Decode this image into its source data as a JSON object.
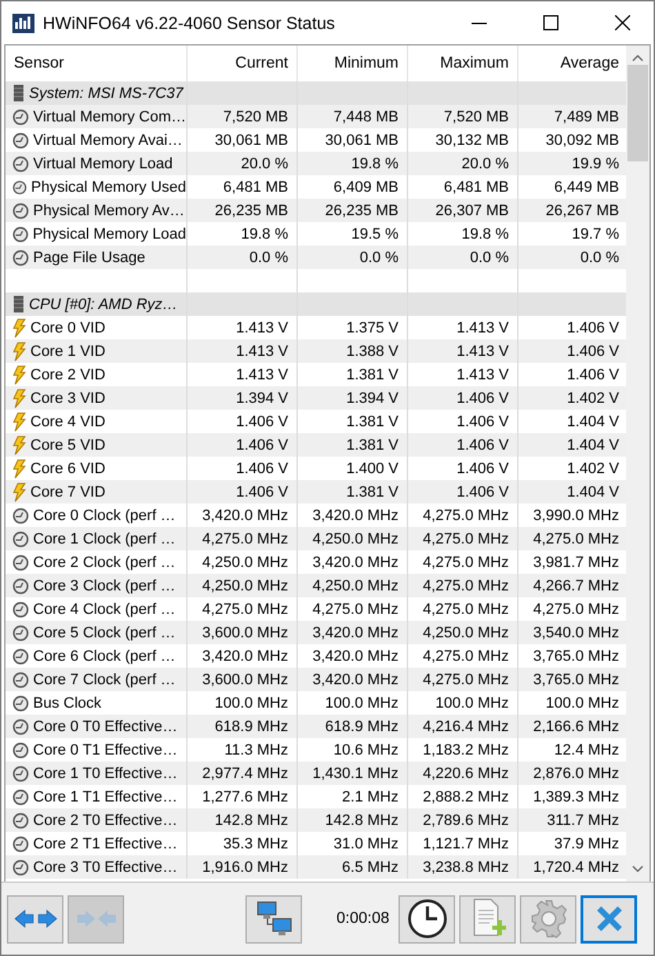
{
  "window": {
    "title": "HWiNFO64 v6.22-4060 Sensor Status"
  },
  "table": {
    "columns": [
      "Sensor",
      "Current",
      "Minimum",
      "Maximum",
      "Average"
    ],
    "rows": [
      {
        "kind": "group",
        "name": "System: MSI MS-7C37"
      },
      {
        "kind": "gauge",
        "name": "Virtual Memory Com…",
        "values": [
          "7,520 MB",
          "7,448 MB",
          "7,520 MB",
          "7,489 MB"
        ]
      },
      {
        "kind": "gauge",
        "name": "Virtual Memory Avai…",
        "values": [
          "30,061 MB",
          "30,061 MB",
          "30,132 MB",
          "30,092 MB"
        ]
      },
      {
        "kind": "gauge",
        "name": "Virtual Memory Load",
        "values": [
          "20.0 %",
          "19.8 %",
          "20.0 %",
          "19.9 %"
        ]
      },
      {
        "kind": "gauge",
        "name": "Physical Memory Used",
        "values": [
          "6,481 MB",
          "6,409 MB",
          "6,481 MB",
          "6,449 MB"
        ]
      },
      {
        "kind": "gauge",
        "name": "Physical Memory Av…",
        "values": [
          "26,235 MB",
          "26,235 MB",
          "26,307 MB",
          "26,267 MB"
        ]
      },
      {
        "kind": "gauge",
        "name": "Physical Memory Load",
        "values": [
          "19.8 %",
          "19.5 %",
          "19.8 %",
          "19.7 %"
        ]
      },
      {
        "kind": "gauge",
        "name": "Page File Usage",
        "values": [
          "0.0 %",
          "0.0 %",
          "0.0 %",
          "0.0 %"
        ]
      },
      {
        "kind": "blank"
      },
      {
        "kind": "group",
        "name": "CPU [#0]: AMD Ryz…"
      },
      {
        "kind": "voltage",
        "name": "Core 0 VID",
        "values": [
          "1.413 V",
          "1.375 V",
          "1.413 V",
          "1.406 V"
        ]
      },
      {
        "kind": "voltage",
        "name": "Core 1 VID",
        "values": [
          "1.413 V",
          "1.388 V",
          "1.413 V",
          "1.406 V"
        ]
      },
      {
        "kind": "voltage",
        "name": "Core 2 VID",
        "values": [
          "1.413 V",
          "1.381 V",
          "1.413 V",
          "1.406 V"
        ]
      },
      {
        "kind": "voltage",
        "name": "Core 3 VID",
        "values": [
          "1.394 V",
          "1.394 V",
          "1.406 V",
          "1.402 V"
        ]
      },
      {
        "kind": "voltage",
        "name": "Core 4 VID",
        "values": [
          "1.406 V",
          "1.381 V",
          "1.406 V",
          "1.404 V"
        ]
      },
      {
        "kind": "voltage",
        "name": "Core 5 VID",
        "values": [
          "1.406 V",
          "1.381 V",
          "1.406 V",
          "1.404 V"
        ]
      },
      {
        "kind": "voltage",
        "name": "Core 6 VID",
        "values": [
          "1.406 V",
          "1.400 V",
          "1.406 V",
          "1.402 V"
        ]
      },
      {
        "kind": "voltage",
        "name": "Core 7 VID",
        "values": [
          "1.406 V",
          "1.381 V",
          "1.406 V",
          "1.404 V"
        ]
      },
      {
        "kind": "gauge",
        "name": "Core 0 Clock (perf …",
        "values": [
          "3,420.0 MHz",
          "3,420.0 MHz",
          "4,275.0 MHz",
          "3,990.0 MHz"
        ]
      },
      {
        "kind": "gauge",
        "name": "Core 1 Clock (perf …",
        "values": [
          "4,275.0 MHz",
          "4,250.0 MHz",
          "4,275.0 MHz",
          "4,275.0 MHz"
        ]
      },
      {
        "kind": "gauge",
        "name": "Core 2 Clock (perf …",
        "values": [
          "4,250.0 MHz",
          "3,420.0 MHz",
          "4,275.0 MHz",
          "3,981.7 MHz"
        ]
      },
      {
        "kind": "gauge",
        "name": "Core 3 Clock (perf …",
        "values": [
          "4,250.0 MHz",
          "4,250.0 MHz",
          "4,275.0 MHz",
          "4,266.7 MHz"
        ]
      },
      {
        "kind": "gauge",
        "name": "Core 4 Clock (perf …",
        "values": [
          "4,275.0 MHz",
          "4,275.0 MHz",
          "4,275.0 MHz",
          "4,275.0 MHz"
        ]
      },
      {
        "kind": "gauge",
        "name": "Core 5 Clock (perf …",
        "values": [
          "3,600.0 MHz",
          "3,420.0 MHz",
          "4,250.0 MHz",
          "3,540.0 MHz"
        ]
      },
      {
        "kind": "gauge",
        "name": "Core 6 Clock (perf …",
        "values": [
          "3,420.0 MHz",
          "3,420.0 MHz",
          "4,275.0 MHz",
          "3,765.0 MHz"
        ]
      },
      {
        "kind": "gauge",
        "name": "Core 7 Clock (perf …",
        "values": [
          "3,600.0 MHz",
          "3,420.0 MHz",
          "4,275.0 MHz",
          "3,765.0 MHz"
        ]
      },
      {
        "kind": "gauge",
        "name": "Bus Clock",
        "values": [
          "100.0 MHz",
          "100.0 MHz",
          "100.0 MHz",
          "100.0 MHz"
        ]
      },
      {
        "kind": "gauge",
        "name": "Core 0 T0 Effective…",
        "values": [
          "618.9 MHz",
          "618.9 MHz",
          "4,216.4 MHz",
          "2,166.6 MHz"
        ]
      },
      {
        "kind": "gauge",
        "name": "Core 0 T1 Effective…",
        "values": [
          "11.3 MHz",
          "10.6 MHz",
          "1,183.2 MHz",
          "12.4 MHz"
        ]
      },
      {
        "kind": "gauge",
        "name": "Core 1 T0 Effective…",
        "values": [
          "2,977.4 MHz",
          "1,430.1 MHz",
          "4,220.6 MHz",
          "2,876.0 MHz"
        ]
      },
      {
        "kind": "gauge",
        "name": "Core 1 T1 Effective…",
        "values": [
          "1,277.6 MHz",
          "2.1 MHz",
          "2,888.2 MHz",
          "1,389.3 MHz"
        ]
      },
      {
        "kind": "gauge",
        "name": "Core 2 T0 Effective…",
        "values": [
          "142.8 MHz",
          "142.8 MHz",
          "2,789.6 MHz",
          "311.7 MHz"
        ]
      },
      {
        "kind": "gauge",
        "name": "Core 2 T1 Effective…",
        "values": [
          "35.3 MHz",
          "31.0 MHz",
          "1,121.7 MHz",
          "37.9 MHz"
        ]
      },
      {
        "kind": "gauge",
        "name": "Core 3 T0 Effective…",
        "values": [
          "1,916.0 MHz",
          "6.5 MHz",
          "3,238.8 MHz",
          "1,720.4 MHz"
        ]
      }
    ]
  },
  "toolbar": {
    "elapsed": "0:00:08",
    "buttons": [
      {
        "kind": "expand",
        "disabled": false,
        "focused": false
      },
      {
        "kind": "collapse",
        "disabled": true,
        "focused": false
      },
      {
        "kind": "network",
        "disabled": false,
        "focused": false
      },
      {
        "kind": "clock",
        "disabled": false,
        "focused": false
      },
      {
        "kind": "report",
        "disabled": false,
        "focused": false
      },
      {
        "kind": "settings",
        "disabled": false,
        "focused": false
      },
      {
        "kind": "close",
        "disabled": false,
        "focused": true
      }
    ]
  }
}
